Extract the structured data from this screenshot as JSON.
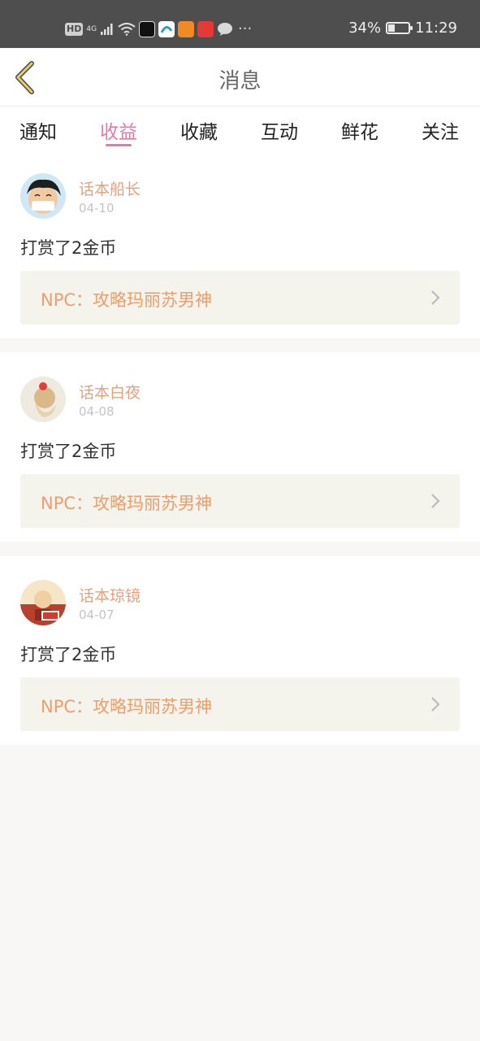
{
  "status_bar": {
    "hd": "HD",
    "signal": "4G",
    "battery": "34%",
    "battery_level": 0.34,
    "time": "11:29",
    "app_icon_colors": [
      "#111111",
      "#2d9cdb",
      "#f08a24",
      "#e53935"
    ],
    "more": "···"
  },
  "header": {
    "title": "消息",
    "back_icon": "chevron-left-icon"
  },
  "tabs": [
    {
      "label": "通知",
      "active": false
    },
    {
      "label": "收益",
      "active": true
    },
    {
      "label": "收藏",
      "active": false
    },
    {
      "label": "互动",
      "active": false
    },
    {
      "label": "鲜花",
      "active": false
    },
    {
      "label": "关注",
      "active": false
    }
  ],
  "messages": [
    {
      "name": "话本船长",
      "date": "04-10",
      "content": "打赏了2金币",
      "link": "NPC：攻略玛丽苏男神"
    },
    {
      "name": "话本白夜",
      "date": "04-08",
      "content": "打赏了2金币",
      "link": "NPC：攻略玛丽苏男神"
    },
    {
      "name": "话本琼镜",
      "date": "04-07",
      "content": "打赏了2金币",
      "link": "NPC：攻略玛丽苏男神"
    }
  ],
  "colors": {
    "accent": "#e27ba9",
    "name": "#e8a07b",
    "link_text": "#ee9d6b",
    "link_bg": "#f4f4ed",
    "back_arrow": "#e3ce6b"
  }
}
